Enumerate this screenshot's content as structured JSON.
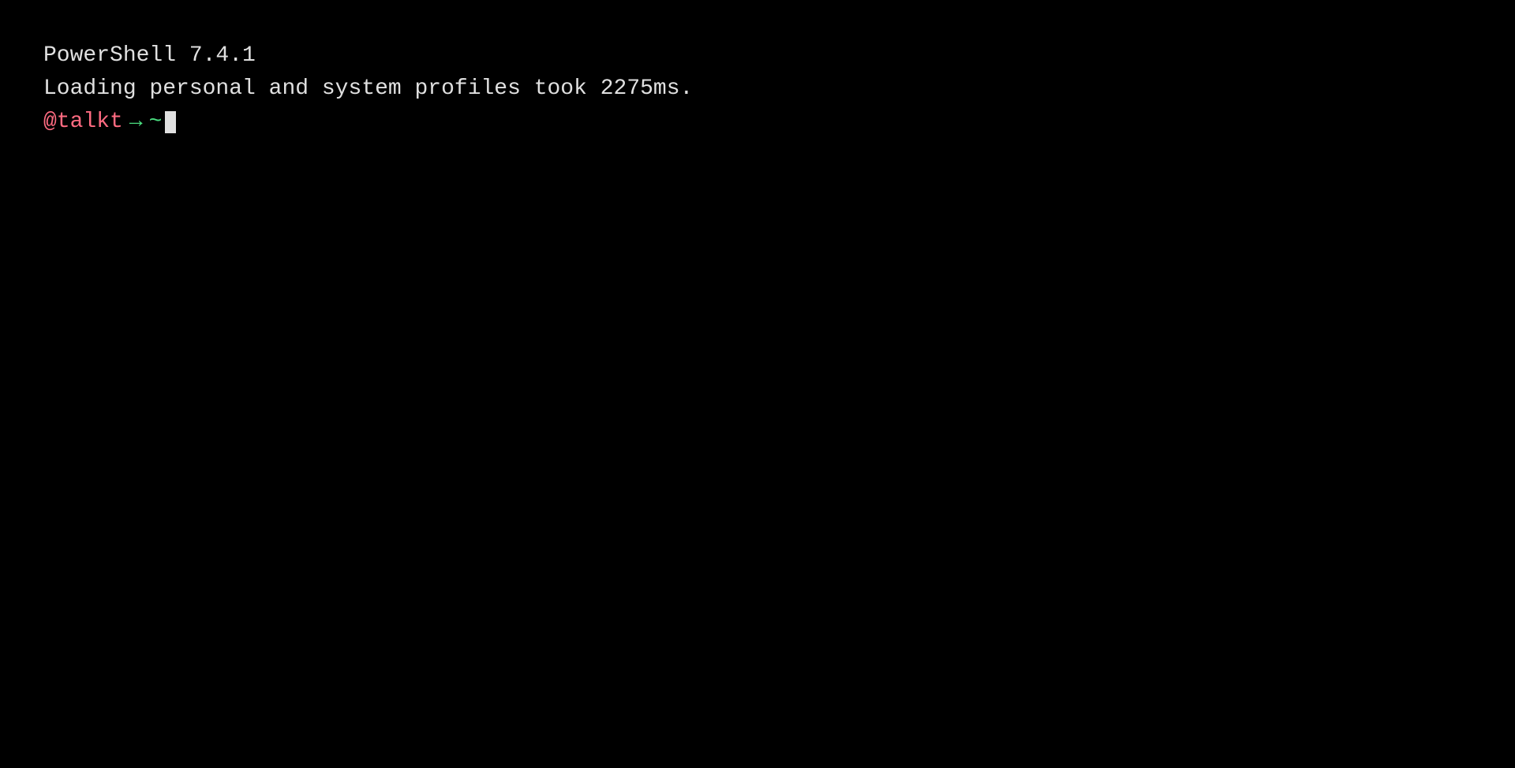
{
  "terminal": {
    "version_line": "PowerShell 7.4.1",
    "loading_line": "Loading personal and system profiles took 2275ms.",
    "prompt": {
      "user": "@talkt",
      "arrow": "→",
      "directory": "~"
    }
  }
}
